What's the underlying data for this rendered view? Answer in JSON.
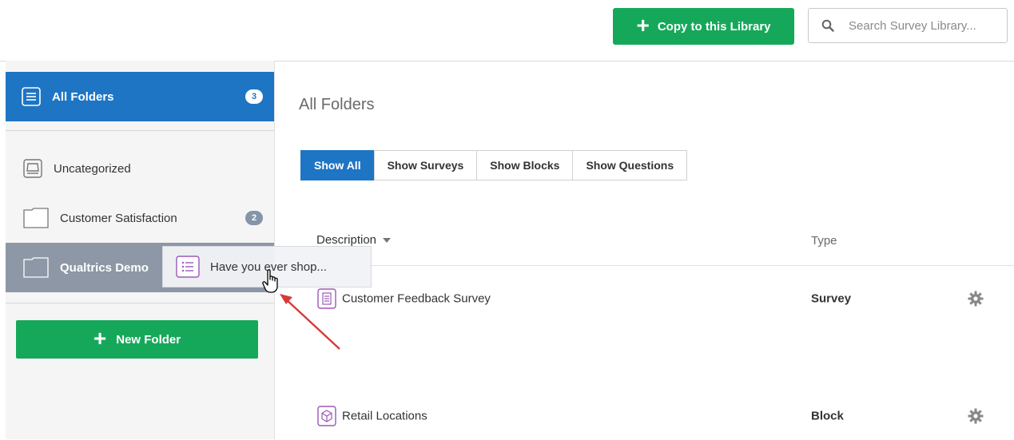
{
  "toolbar": {
    "copy_label": "Copy to this Library",
    "search_placeholder": "Search Survey Library..."
  },
  "sidebar": {
    "items": [
      {
        "label": "All Folders",
        "count": "3",
        "selected": true
      },
      {
        "label": "Uncategorized"
      },
      {
        "label": "Customer Satisfaction",
        "count": "2"
      },
      {
        "label": "Qualtrics Demo",
        "hovered": true
      }
    ],
    "new_folder_label": "New Folder"
  },
  "main": {
    "title": "All Folders",
    "filters": [
      "Show All",
      "Show Surveys",
      "Show Blocks",
      "Show Questions"
    ],
    "active_filter": "Show All",
    "columns": {
      "description": "Description",
      "type": "Type"
    },
    "rows": [
      {
        "name": "Customer Feedback Survey",
        "type": "Survey",
        "icon": "survey-icon"
      },
      {
        "name": "Retail Locations",
        "type": "Block",
        "icon": "block-icon"
      }
    ]
  },
  "drag": {
    "label": "Have you ever shop...",
    "icon": "question-list-icon"
  },
  "colors": {
    "accent_blue": "#1d75c4",
    "green": "#16a85a",
    "hover_gray": "#8e97a6",
    "purple_icon": "#9b59b6",
    "annotation_red": "#d9393a"
  }
}
